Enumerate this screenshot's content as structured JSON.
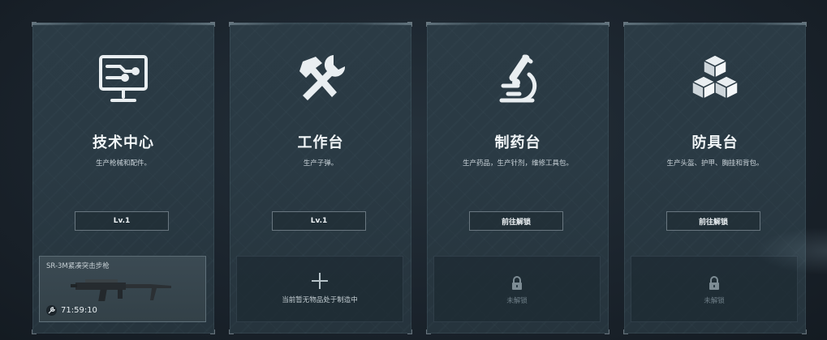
{
  "stations": [
    {
      "name": "技术中心",
      "description": "生产枪械和配件。",
      "button_label": "Lv.1",
      "icon": "monitor-circuit-icon",
      "slot": {
        "state": "crafting",
        "item_name": "SR-3M紧凑突击步枪",
        "timer": "71:59:10",
        "icon": "wrench-icon"
      }
    },
    {
      "name": "工作台",
      "description": "生产子弹。",
      "button_label": "Lv.1",
      "icon": "hammer-wrench-icon",
      "slot": {
        "state": "empty",
        "message": "当前暂无物品处于制造中",
        "icon": "plus-icon"
      }
    },
    {
      "name": "制药台",
      "description": "生产药品，生产针剂，维修工具包。",
      "button_label": "前往解锁",
      "icon": "microscope-icon",
      "slot": {
        "state": "locked",
        "message": "未解锁",
        "icon": "lock-icon"
      }
    },
    {
      "name": "防具台",
      "description": "生产头盔、护甲、胸挂和背包。",
      "button_label": "前往解锁",
      "icon": "cubes-icon",
      "slot": {
        "state": "locked",
        "message": "未解锁",
        "icon": "lock-icon"
      }
    }
  ],
  "colors": {
    "card_bg": "#2a3a44",
    "text_primary": "#f2f6f8",
    "text_muted": "#6f7f88"
  }
}
